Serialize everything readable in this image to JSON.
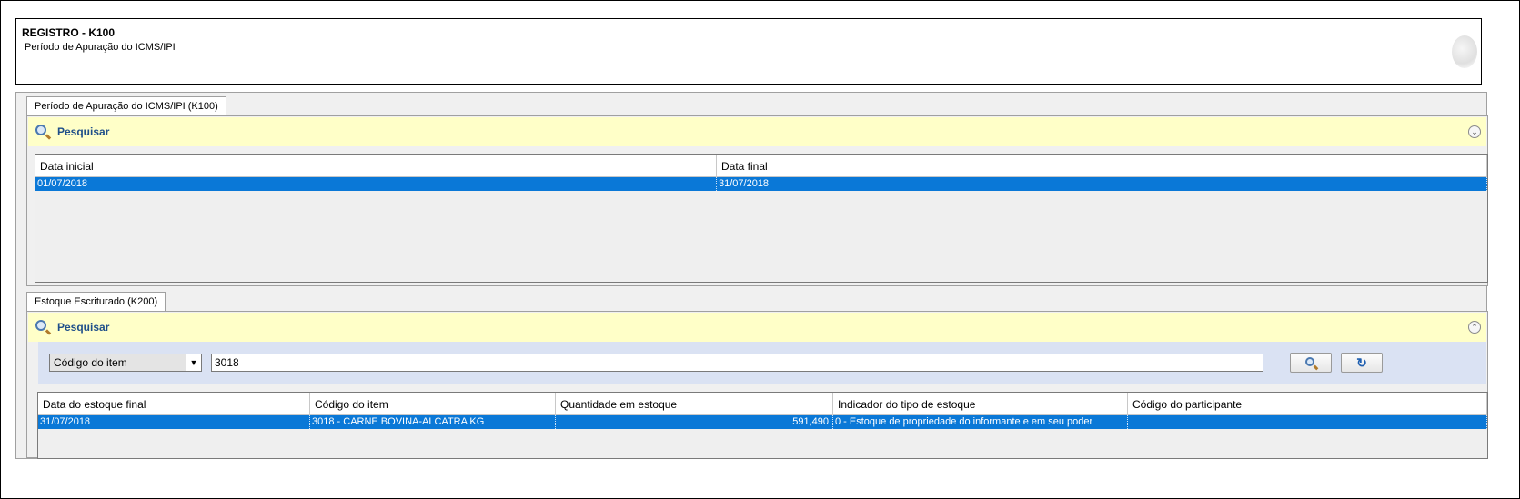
{
  "header": {
    "title": "REGISTRO - K100",
    "subtitle": "Período de Apuração do ICMS/IPI"
  },
  "tab_k100": {
    "label": "Período de Apuração do ICMS/IPI (K100)"
  },
  "search_k100": {
    "label": "Pesquisar"
  },
  "grid_k100": {
    "columns": [
      "Data inicial",
      "Data final"
    ],
    "rows": [
      [
        "01/07/2018",
        "31/07/2018"
      ]
    ]
  },
  "tab_k200": {
    "label": "Estoque Escriturado (K200)"
  },
  "search_k200": {
    "label": "Pesquisar",
    "field_select": "Código do item",
    "query": "3018"
  },
  "grid_k200": {
    "columns": [
      "Data do estoque final",
      "Código do item",
      "Quantidade em estoque",
      "Indicador do tipo de estoque",
      "Código do participante"
    ],
    "rows": [
      [
        "31/07/2018",
        "3018 - CARNE BOVINA-ALCATRA KG",
        "591,490",
        "0 - Estoque de propriedade do informante e em seu poder",
        ""
      ]
    ]
  },
  "colors": {
    "selection": "#0a78d7",
    "search_bar": "#ffffc8",
    "filter_bar": "#dae2f3"
  }
}
